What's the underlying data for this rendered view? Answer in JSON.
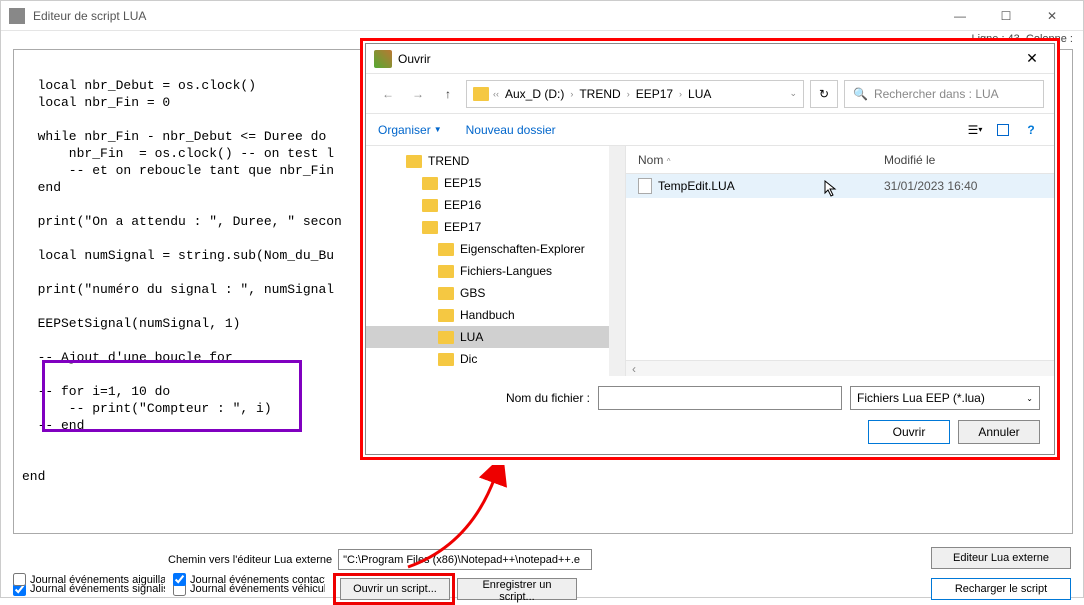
{
  "main": {
    "title": "Editeur de script LUA",
    "status": "Ligne : 43, Colonne :",
    "code": "\n  local nbr_Debut = os.clock()\n  local nbr_Fin = 0\n\n  while nbr_Fin - nbr_Debut <= Duree do\n      nbr_Fin  = os.clock() -- on test l\n      -- et on reboucle tant que nbr_Fin\n  end\n\n  print(\"On a attendu : \", Duree, \" secon\n\n  local numSignal = string.sub(Nom_du_Bu\n\n  print(\"numéro du signal : \", numSignal\n\n  EEPSetSignal(numSignal, 1)\n\n  -- Ajout d'une boucle for\n\n  -- for i=1, 10 do\n      -- print(\"Compteur : \", i)\n  -- end\n\n\nend"
  },
  "bottom": {
    "path_label": "Chemin vers l'éditeur Lua externe",
    "path_value": "\"C:\\Program Files (x86)\\Notepad++\\notepad++.e",
    "cb1": "Journal événements signalisa",
    "cb2": "Journal événements aiguillag",
    "cb3": "Journal événements véhicule",
    "cb4": "Journal événements contacts",
    "btn_open": "Ouvrir un script...",
    "btn_save": "Enregistrer un script...",
    "btn_ext": "Editeur Lua externe",
    "btn_reload": "Recharger le script"
  },
  "dialog": {
    "title": "Ouvrir",
    "breadcrumb": [
      "Aux_D (D:)",
      "TREND",
      "EEP17",
      "LUA"
    ],
    "search_placeholder": "Rechercher dans : LUA",
    "organize": "Organiser",
    "new_folder": "Nouveau dossier",
    "tree": [
      {
        "label": "TREND",
        "indent": 0
      },
      {
        "label": "EEP15",
        "indent": 1
      },
      {
        "label": "EEP16",
        "indent": 1
      },
      {
        "label": "EEP17",
        "indent": 1
      },
      {
        "label": "Eigenschaften-Explorer",
        "indent": 2
      },
      {
        "label": "Fichiers-Langues",
        "indent": 2
      },
      {
        "label": "GBS",
        "indent": 2
      },
      {
        "label": "Handbuch",
        "indent": 2
      },
      {
        "label": "LUA",
        "indent": 2,
        "selected": true
      },
      {
        "label": "Dic",
        "indent": 2
      }
    ],
    "col_name": "Nom",
    "col_mod": "Modifié le",
    "files": [
      {
        "name": "TempEdit.LUA",
        "mod": "31/01/2023 16:40"
      }
    ],
    "fn_label": "Nom du fichier :",
    "fn_value": "",
    "filter": "Fichiers Lua EEP (*.lua)",
    "btn_open": "Ouvrir",
    "btn_cancel": "Annuler"
  }
}
